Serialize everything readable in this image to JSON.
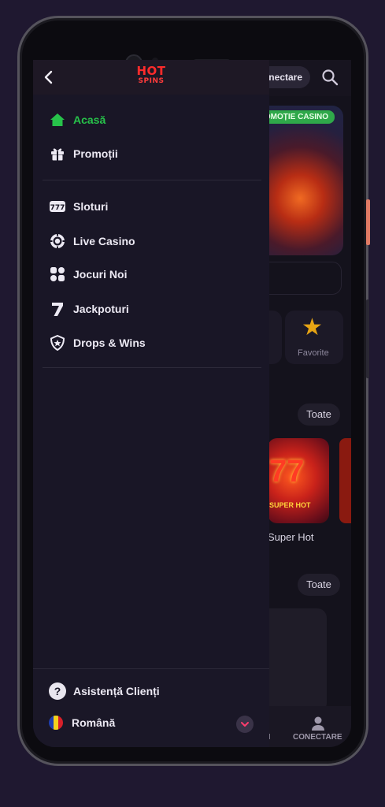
{
  "header": {
    "logo_top": "HOT",
    "logo_bottom": "SPINS",
    "login_label": "Conectare"
  },
  "menu": {
    "primary": [
      {
        "label": "Acasă",
        "icon": "home-icon",
        "active": true
      },
      {
        "label": "Promoții",
        "icon": "gift-icon",
        "active": false
      }
    ],
    "games": [
      {
        "label": "Sloturi",
        "icon": "slots-icon"
      },
      {
        "label": "Live Casino",
        "icon": "chip-icon"
      },
      {
        "label": "Jocuri Noi",
        "icon": "grid-icon"
      },
      {
        "label": "Jackpoturi",
        "icon": "seven-icon"
      },
      {
        "label": "Drops & Wins",
        "icon": "shield-star-icon"
      }
    ]
  },
  "footer": {
    "help_label": "Asistență Clienți",
    "language_label": "Română"
  },
  "background": {
    "promo_tag": "PROMOȚIE CASINO",
    "favorite_label": "Favorite",
    "see_all_1": "Toate",
    "see_all_2": "Toate",
    "game_title": "Super Hot",
    "game_badge": "SUPER HOT",
    "nav_partial": "II",
    "nav_login": "CONECTARE"
  },
  "colors": {
    "active": "#27c24a",
    "drawer_bg": "#191626",
    "logo_red": "#ff2b2b",
    "flag": [
      "#1f3fb0",
      "#f3d21c",
      "#d8202a"
    ]
  }
}
